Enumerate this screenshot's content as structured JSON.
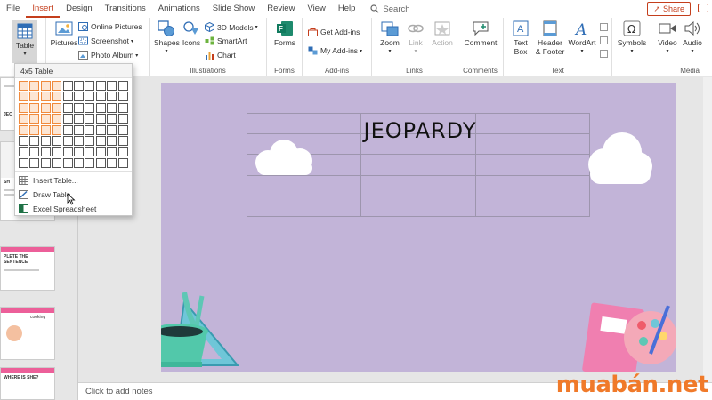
{
  "tabs": [
    "File",
    "Insert",
    "Design",
    "Transitions",
    "Animations",
    "Slide Show",
    "Review",
    "View",
    "Help"
  ],
  "active_tab": "Insert",
  "search_label": "Search",
  "share_label": "Share",
  "ribbon": {
    "table": "Table",
    "pictures": "Pictures",
    "online_pictures": "Online Pictures",
    "screenshot": "Screenshot",
    "photo_album": "Photo Album",
    "shapes": "Shapes",
    "icons": "Icons",
    "models_3d": "3D Models",
    "smartart": "SmartArt",
    "chart": "Chart",
    "illustrations": "Illustrations",
    "forms": "Forms",
    "forms_group": "Forms",
    "get_addins": "Get Add-ins",
    "my_addins": "My Add-ins",
    "addins_group": "Add-ins",
    "zoom": "Zoom",
    "link": "Link",
    "action": "Action",
    "links_group": "Links",
    "comment": "Comment",
    "comments_group": "Comments",
    "text_box_1": "Text",
    "text_box_2": "Box",
    "header_footer_1": "Header",
    "header_footer_2": "& Footer",
    "wordart": "WordArt",
    "text_group": "Text",
    "symbols": "Symbols",
    "video": "Video",
    "audio": "Audio",
    "media_group": "Media"
  },
  "dropdown": {
    "title": "4x5 Table",
    "grid_cols": 10,
    "grid_rows": 8,
    "selected_cols": 4,
    "selected_rows": 5,
    "insert_table": "Insert Table...",
    "draw_table": "Draw Table",
    "excel": "Excel Spreadsheet"
  },
  "slide": {
    "title": "JEOPARDY"
  },
  "thumbnails": [
    {
      "text": "JEO"
    },
    {
      "text": "SH"
    },
    {
      "text": "PLETE THE SENTENCE"
    },
    {
      "text": "cooking"
    },
    {
      "text": "WHERE IS SHE?"
    }
  ],
  "notes_placeholder": "Click to add notes",
  "watermark": "muabán.net",
  "colors": {
    "accent": "#c43e1c",
    "slide_bg": "#c2b4d8",
    "grid_select": "#f08a3c",
    "watermark": "#f07a2a"
  }
}
